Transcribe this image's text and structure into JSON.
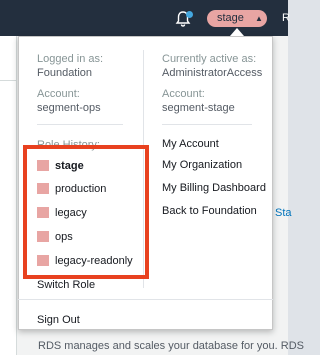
{
  "topbar": {
    "account_label": "stage",
    "bell_icon": "bell-icon",
    "notification_color": "#44a8e0",
    "account_pill_color": "#e8a5a3"
  },
  "background": {
    "link_fragment": "Sta",
    "footer_text": "RDS manages and scales your database for you. RDS"
  },
  "menu": {
    "logged_in_label": "Logged in as:",
    "logged_in_value": "Foundation",
    "account_label": "Account:",
    "account_value": "segment-ops",
    "active_label": "Currently active as:",
    "active_value": "AdministratorAccess",
    "active_account_label": "Account:",
    "active_account_value": "segment-stage",
    "role_history_label": "Role History:",
    "roles": [
      {
        "label": "stage",
        "active": true
      },
      {
        "label": "production",
        "active": false
      },
      {
        "label": "legacy",
        "active": false
      },
      {
        "label": "ops",
        "active": false
      },
      {
        "label": "legacy-readonly",
        "active": false
      }
    ],
    "role_color": "#e8a5a3",
    "links": {
      "my_account": "My Account",
      "my_organization": "My Organization",
      "my_billing": "My Billing Dashboard",
      "back_to": "Back to Foundation"
    },
    "switch_role": "Switch Role",
    "sign_out": "Sign Out",
    "highlight_color": "#e8411f"
  }
}
